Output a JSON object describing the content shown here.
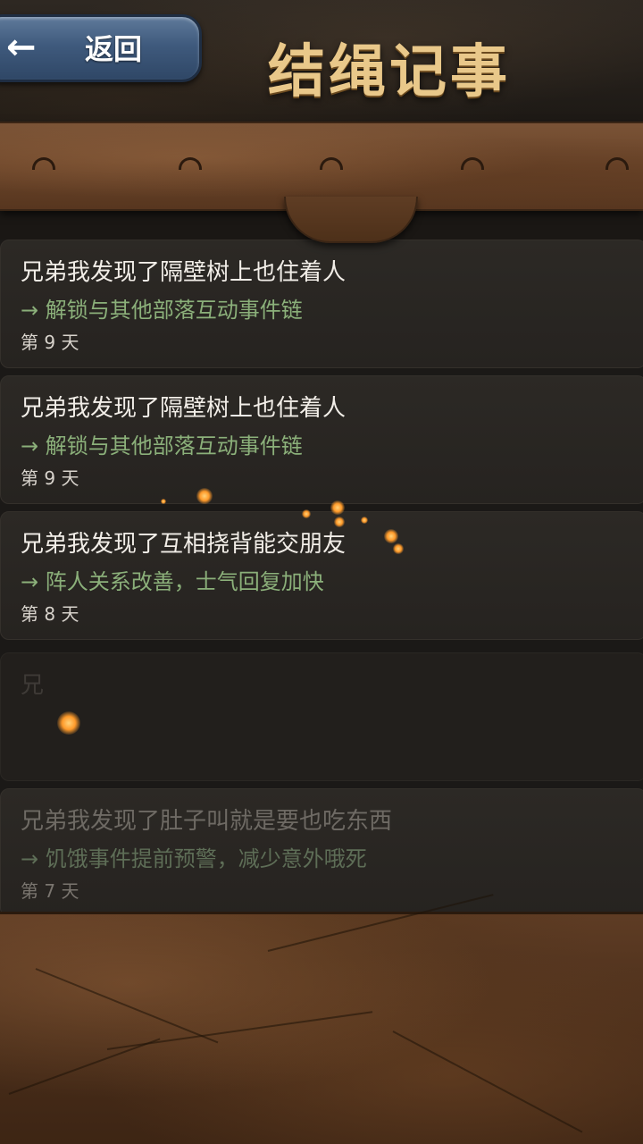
{
  "header": {
    "back_label": "返回",
    "back_icon": "arrow-left-icon",
    "title": "结绳记事"
  },
  "entries": [
    {
      "title": "兄弟我发现了隔壁树上也住着人",
      "effect": "→ 解锁与其他部落互动事件链",
      "day": "第 9 天"
    },
    {
      "title": "兄弟我发现了隔壁树上也住着人",
      "effect": "→ 解锁与其他部落互动事件链",
      "day": "第 9 天"
    },
    {
      "title": "兄弟我发现了互相挠背能交朋友",
      "effect": "→ 阵人关系改善，士气回复加快",
      "day": "第 8 天"
    },
    {
      "title": "兄",
      "effect": "",
      "day": ""
    },
    {
      "title": "兄弟我发现了肚子叫就是要也吃东西",
      "effect": "→ 饥饿事件提前预警，减少意外哦死",
      "day": "第 7 天"
    }
  ],
  "colors": {
    "title_gold": "#e9c88a",
    "effect_green": "#8bb07a",
    "back_button_blue": "#3f5a7d",
    "leather_brown": "#6a4429"
  }
}
